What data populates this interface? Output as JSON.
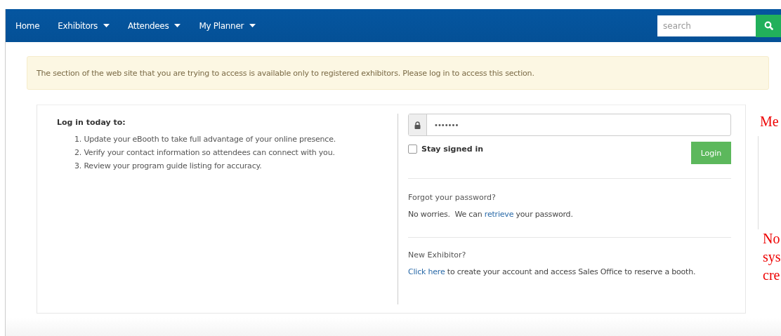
{
  "nav": {
    "items": [
      {
        "label": "Home",
        "dropdown": false
      },
      {
        "label": "Exhibitors",
        "dropdown": true
      },
      {
        "label": "Attendees",
        "dropdown": true
      },
      {
        "label": "My Planner",
        "dropdown": true
      }
    ],
    "search": {
      "placeholder": "search"
    }
  },
  "alert": "The section of the web site that you are trying to access is available only to registered exhibitors. Please log in to access this section.",
  "intro": {
    "heading": "Log in today to:",
    "steps": [
      "1. Update your eBooth to take full advantage of your online presence.",
      "2. Verify your contact information so attendees can connect with you.",
      "3. Review your program guide listing for accuracy."
    ]
  },
  "login": {
    "password": "•••••••",
    "stay_signed_in": {
      "label": "Stay signed in",
      "checked": false
    },
    "button": "Login"
  },
  "forgot": {
    "heading": "Forgot your password?",
    "before": "No worries.  We can ",
    "link": "retrieve",
    "after": " your password."
  },
  "new_exhibitor": {
    "heading": "New Exhibitor?",
    "link": "Click here",
    "after": " to create your account and access Sales Office to reserve a booth."
  },
  "side_notes": [
    "Me",
    "No",
    "sys",
    "cre"
  ]
}
